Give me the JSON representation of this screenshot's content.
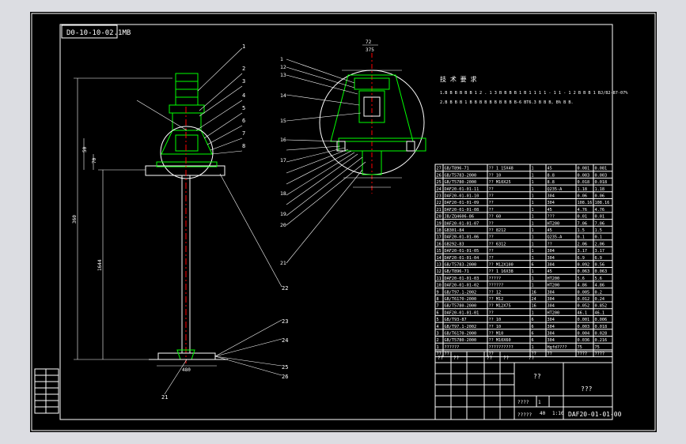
{
  "drawing": {
    "header_code": "D0-10-10-02.1MB",
    "drawing_number": "DAF20-01-01-00",
    "title_cells": [
      "??",
      "???"
    ],
    "notes_title": "技 术 要 求",
    "notes": [
      "1.B B B B B B 1 2 . 1 3  B B B B 1 B 1 1 1 1 - 1 1 - 1 2  B B B 1 BJ/82-87-07%",
      "2.B B B B 1 B B B B B B B B B B-6 BT6.3 B B B, B% B B."
    ],
    "top_dims": [
      "72",
      "375"
    ],
    "side_dims": [
      "50",
      "70",
      "360",
      "1644"
    ],
    "bottom_dims": [
      "480",
      "870"
    ],
    "title_small": [
      "????",
      "?????",
      "1",
      "40",
      "1:10"
    ]
  },
  "balloons_right": [
    "1",
    "2",
    "3",
    "4",
    "5",
    "6",
    "7",
    "8",
    "22",
    "23",
    "24",
    "25",
    "26"
  ],
  "balloons_left": [
    "1",
    "12",
    "13",
    "14",
    "15",
    "16",
    "17",
    "18",
    "19",
    "20",
    "21"
  ],
  "balloon_bottom": "21",
  "bom_rows": [
    [
      "27",
      "GB/T896-71",
      "?? 1 15X48",
      "1",
      "45",
      "0.081",
      "0.081"
    ],
    [
      "26",
      "GB/T5783-2000",
      "?? 10",
      "1",
      "8.8",
      "0.003",
      "0.003"
    ],
    [
      "25",
      "GB/T5780-2000",
      "?? M10X25",
      "1",
      "8.8",
      "0.018",
      "0.018"
    ],
    [
      "24",
      "DAF20-01-01-11",
      "??",
      "1",
      "Q235-A",
      "1.18",
      "1.18"
    ],
    [
      "23",
      "DAF20-01-01-10",
      "??",
      "1",
      "304",
      "0.06",
      "0.06"
    ],
    [
      "22",
      "DAF20-01-01-09",
      "??",
      "1",
      "304",
      "108.16",
      "108.16"
    ],
    [
      "21",
      "DAF20-01-01-08",
      "??",
      "1",
      "45",
      "4.76",
      "4.76"
    ],
    [
      "20",
      "JB/ZQ4606-86",
      "?? 60",
      "1",
      "???",
      "0.01",
      "0.01"
    ],
    [
      "19",
      "DAF20-01-01-07",
      "??",
      "1",
      "HT200",
      "7.06",
      "7.06"
    ],
    [
      "18",
      "GB301-84",
      "?? 8212",
      "1",
      "45",
      "1.5",
      "1.5"
    ],
    [
      "17",
      "DAF20-01-01-06",
      "??",
      "1",
      "Q235-A",
      "0.1",
      "0.1"
    ],
    [
      "16",
      "GB292-83",
      "?? 6312",
      "1",
      "??",
      "2.06",
      "2.06"
    ],
    [
      "15",
      "DAF20-01-01-05",
      "??",
      "1",
      "304",
      "3.17",
      "3.17"
    ],
    [
      "14",
      "DAF20-01-01-04",
      "??",
      "1",
      "304",
      "6.9",
      "6.9"
    ],
    [
      "13",
      "GB/T5783-2000",
      "?? M12X100",
      "6",
      "304",
      "0.092",
      "0.56"
    ],
    [
      "12",
      "GB/T896-71",
      "?? 1 16X38",
      "1",
      "45",
      "0.063",
      "0.063"
    ],
    [
      "11",
      "DAF20-01-01-03",
      "?????",
      "1",
      "HT200",
      "5.6",
      "5.6"
    ],
    [
      "10",
      "DAF20-01-01-02",
      "??????",
      "1",
      "HT200",
      "4.86",
      "4.86"
    ],
    [
      "9",
      "GB/T97.1-2002",
      "?? 12",
      "16",
      "304",
      "0.005",
      "0.2"
    ],
    [
      "8",
      "GB/T6170-2000",
      "?? M12",
      "24",
      "304",
      "0.012",
      "0.24"
    ],
    [
      "7",
      "GB/T5780-2000",
      "?? M12X75",
      "16",
      "304",
      "0.052",
      "0.852"
    ],
    [
      "6",
      "DAF20-01-01-01",
      "??",
      "1",
      "HT200",
      "46.1",
      "46.1"
    ],
    [
      "5",
      "GB/T93-87",
      "?? 10",
      "6",
      "304",
      "0.001",
      "0.006"
    ],
    [
      "4",
      "GB/T97.1-2002",
      "?? 10",
      "6",
      "304",
      "0.003",
      "0.018"
    ],
    [
      "3",
      "GB/T6170-2000",
      "?? M10",
      "6",
      "304",
      "0.004",
      "0.028"
    ],
    [
      "2",
      "GB/T5780-2000",
      "?? M10X60",
      "6",
      "304",
      "0.036",
      "0.216"
    ],
    [
      "1",
      "??????",
      "??????????",
      "1",
      "Hgfd????",
      "75",
      "75"
    ]
  ],
  "bom_header": [
    "??",
    "??",
    "??",
    "??",
    "??",
    "????",
    "????"
  ],
  "revision_cells": [
    "??",
    "??",
    "??",
    "??",
    "??"
  ],
  "colors": {
    "background": "#000000",
    "outline": "#ffffff",
    "components": "#00ff00",
    "centerline": "#ff0000",
    "screen_frame": "#dcdde2"
  }
}
